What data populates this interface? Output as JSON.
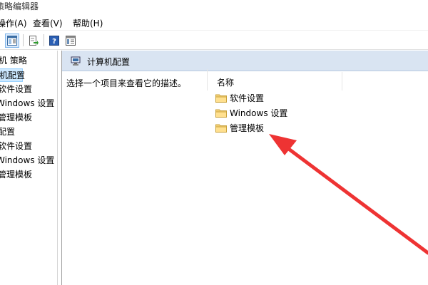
{
  "window": {
    "title": "策略编辑器"
  },
  "menu": [
    {
      "label": "操作(A)"
    },
    {
      "label": "查看(V)"
    },
    {
      "label": "帮助(H)"
    }
  ],
  "toolbar": {
    "icons": [
      "show-hide-tree-icon",
      "export-list-icon",
      "help-icon",
      "properties-icon"
    ]
  },
  "tree": {
    "items": [
      {
        "label": "机 策略"
      },
      {
        "label": "机配置"
      },
      {
        "label": "软件设置"
      },
      {
        "label": "Windows 设置"
      },
      {
        "label": "管理模板"
      },
      {
        "label": "配置"
      },
      {
        "label": "软件设置"
      },
      {
        "label": "Windows 设置"
      },
      {
        "label": "管理模板"
      }
    ],
    "selected_index": 1
  },
  "details": {
    "header_title": "计算机配置",
    "description": "选择一个项目来查看它的描述。",
    "column_name": "名称",
    "items": [
      {
        "label": "软件设置"
      },
      {
        "label": "Windows 设置"
      },
      {
        "label": "管理模板"
      }
    ]
  },
  "annotation": {
    "arrow_color": "#ee3333"
  }
}
